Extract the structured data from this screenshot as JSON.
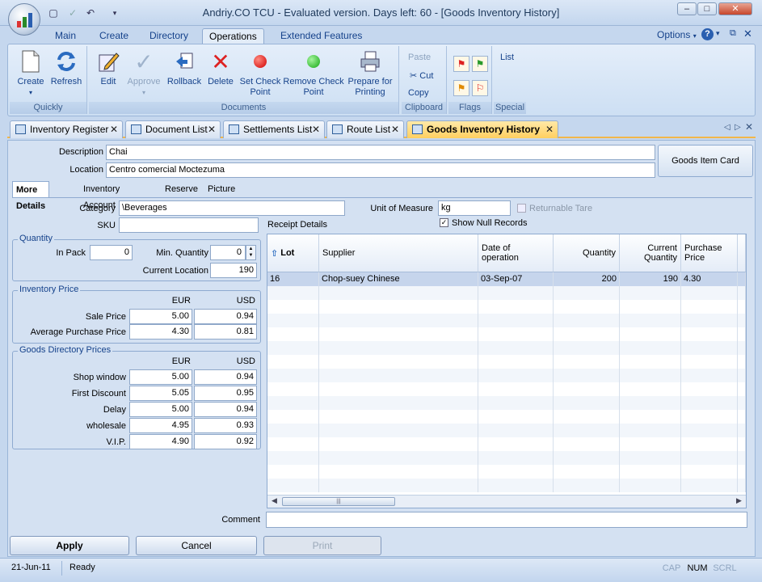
{
  "window": {
    "title": "Andriy.CO TCU - Evaluated version. Days left: 60 - [Goods Inventory History]",
    "minimize": "–",
    "maximize": "□",
    "close": "✕"
  },
  "ribbon_tabs": [
    "Main",
    "Create",
    "Directory",
    "Operations",
    "Extended Features"
  ],
  "ribbon_right": {
    "options": "Options",
    "help": "?"
  },
  "ribbon": {
    "quickly": {
      "label": "Quickly",
      "create": "Create",
      "refresh": "Refresh"
    },
    "documents": {
      "label": "Documents",
      "edit": "Edit",
      "approve": "Approve",
      "rollback": "Rollback",
      "delete": "Delete",
      "set_check_point": "Set Check Point",
      "remove_check_point": "Remove Check Point",
      "prepare_for_printing": "Prepare for Printing"
    },
    "clipboard": {
      "label": "Clipboard",
      "paste": "Paste",
      "cut": "Cut",
      "copy": "Copy"
    },
    "flags": {
      "label": "Flags"
    },
    "special": {
      "label": "Special",
      "list": "List"
    }
  },
  "doc_tabs": [
    "Inventory Register",
    "Document List",
    "Settlements List",
    "Route List",
    "Goods Inventory History"
  ],
  "form": {
    "description_label": "Description",
    "description": "Chai",
    "location_label": "Location",
    "location": "Centro comercial Moctezuma",
    "goods_item_card": "Goods Item Card",
    "subtabs": [
      "More Details",
      "Inventory Account",
      "Reserve",
      "Picture"
    ],
    "category_label": "Category",
    "category": "\\Beverages",
    "sku_label": "SKU",
    "sku": "",
    "unit_label": "Unit of Measure",
    "unit": "kg",
    "returnable_tare": "Returnable Tare",
    "show_null_records": "Show Null Records",
    "receipt_details": "Receipt Details",
    "quantity": {
      "legend": "Quantity",
      "in_pack_label": "In Pack",
      "in_pack": "0",
      "min_qty_label": "Min. Quantity",
      "min_qty": "0",
      "current_location_label": "Current Location",
      "current_location": "190"
    },
    "inventory_price": {
      "legend": "Inventory Price",
      "eur": "EUR",
      "usd": "USD",
      "rows": [
        {
          "label": "Sale Price",
          "eur": "5.00",
          "usd": "0.94"
        },
        {
          "label": "Average Purchase Price",
          "eur": "4.30",
          "usd": "0.81"
        }
      ]
    },
    "directory_prices": {
      "legend": "Goods Directory Prices",
      "eur": "EUR",
      "usd": "USD",
      "rows": [
        {
          "label": "Shop window",
          "eur": "5.00",
          "usd": "0.94"
        },
        {
          "label": "First Discount",
          "eur": "5.05",
          "usd": "0.95"
        },
        {
          "label": "Delay",
          "eur": "5.00",
          "usd": "0.94"
        },
        {
          "label": "wholesale",
          "eur": "4.95",
          "usd": "0.93"
        },
        {
          "label": "V.I.P.",
          "eur": "4.90",
          "usd": "0.92"
        }
      ]
    },
    "comment_label": "Comment",
    "comment": ""
  },
  "grid": {
    "headers": [
      "Lot",
      "Supplier",
      "Date of operation",
      "Quantity",
      "Current Quantity",
      "Purchase Price"
    ],
    "rows": [
      [
        "16",
        "Chop-suey Chinese",
        "03-Sep-07",
        "200",
        "190",
        "4.30"
      ]
    ]
  },
  "buttons": {
    "apply": "Apply",
    "cancel": "Cancel",
    "print": "Print"
  },
  "status": {
    "date": "21-Jun-11",
    "state": "Ready",
    "caps": "CAP",
    "num": "NUM",
    "scrl": "SCRL"
  },
  "colors": {
    "accent": "#f2b64a",
    "header_text": "#15428b",
    "selected_row": "#c6d5ec"
  }
}
